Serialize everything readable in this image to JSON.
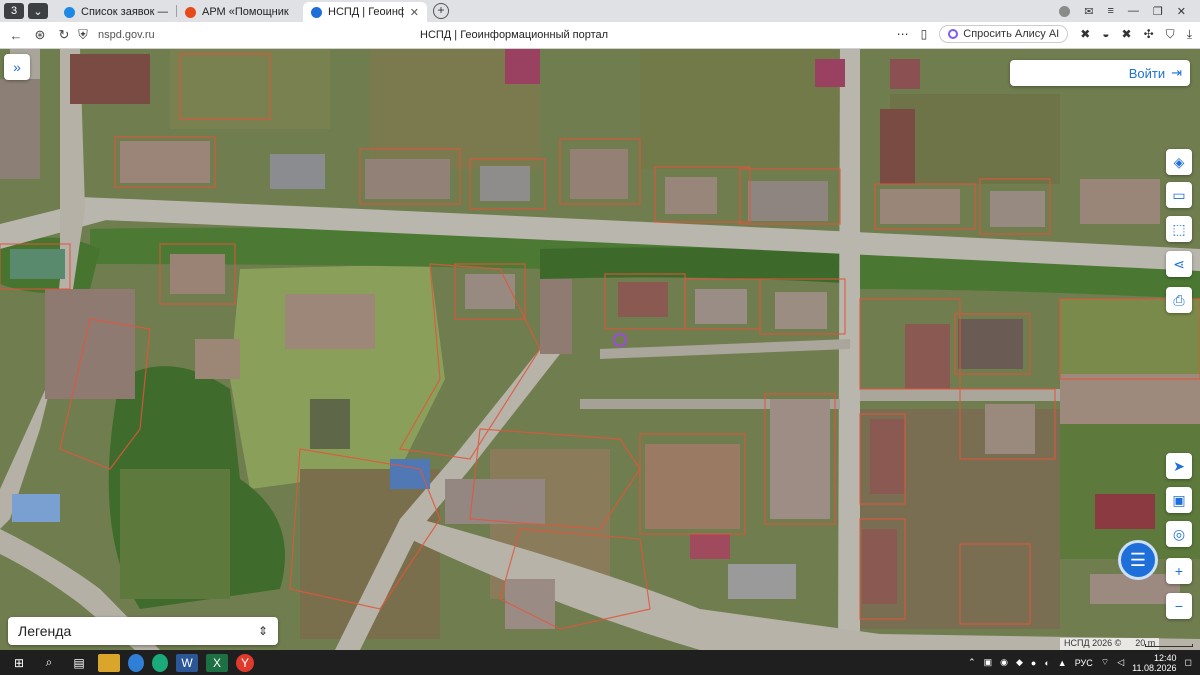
{
  "browser": {
    "tabs": [
      {
        "label": "Список заявок — ТехноК",
        "active": false,
        "favicon_color": "#1e88e5"
      },
      {
        "label": "АРМ «Помощник»",
        "active": false,
        "favicon_color": "#e64a19"
      },
      {
        "label": "НСПД | Геоинформацио",
        "active": true,
        "favicon_color": "#1e6fd9"
      }
    ],
    "tab_count_badge": "3",
    "url": "nspd.gov.ru",
    "page_title": "НСПД | Геоинформационный портал",
    "alice_label": "Спросить Алису AI"
  },
  "map": {
    "login_label": "Войти",
    "legend_label": "Легенда",
    "copyright": "НСПД 2026 ©",
    "scale_label": "20 m",
    "accent_color": "#1e6fd9",
    "parcel_color": "#e2563a",
    "tools_top": [
      "layers-icon",
      "ruler-icon",
      "area-select-icon",
      "share-icon",
      "print-icon"
    ],
    "tools_bottom": [
      "locate-icon",
      "basemap-icon",
      "geolocation-icon"
    ],
    "zoom_in": "+",
    "zoom_out": "−"
  },
  "taskbar": {
    "apps": [
      "start-icon",
      "search-icon",
      "task-view-icon",
      "file-explorer-icon",
      "chrome-icon",
      "edge-icon",
      "word-icon",
      "excel-icon",
      "yandex-browser-icon"
    ],
    "lang": "РУС",
    "time": "12:40",
    "date": "11.08.2026"
  }
}
